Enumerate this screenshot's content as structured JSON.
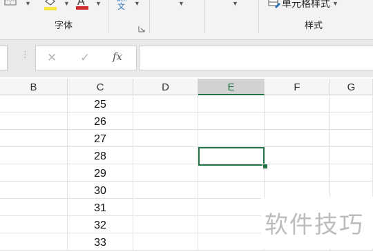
{
  "ribbon": {
    "font_group_label": "字体",
    "style_group_label": "样式",
    "cell_styles_label": "单元格样式",
    "colors": {
      "fill_color": "#f5e642",
      "font_color": "#d22b2b"
    }
  },
  "formula_bar": {
    "cancel_symbol": "✕",
    "confirm_symbol": "✓",
    "fx_symbol": "fx",
    "name_box_value": "",
    "formula_value": ""
  },
  "grid": {
    "columns": [
      "B",
      "C",
      "D",
      "E",
      "F",
      "G"
    ],
    "selected_column": "E",
    "column_c_values": [
      "25",
      "26",
      "27",
      "28",
      "29",
      "30",
      "31",
      "32",
      "33"
    ]
  },
  "watermark": {
    "text": "软件技巧"
  },
  "colors": {
    "accent": "#217346",
    "ribbon_bg": "#f3f3f3",
    "header_bg": "#f6f6f6"
  }
}
